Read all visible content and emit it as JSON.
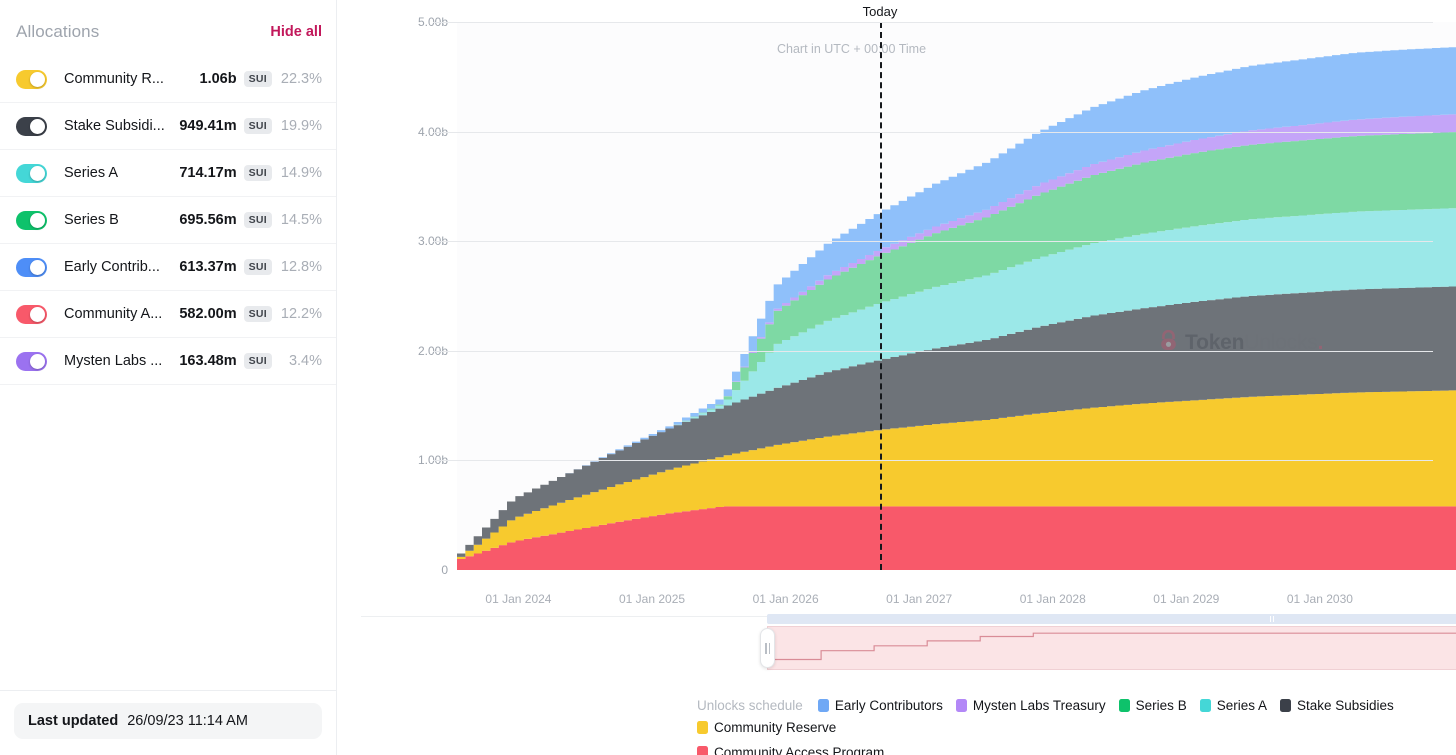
{
  "sidebar": {
    "title": "Allocations",
    "hide_all_label": "Hide all",
    "symbol": "SUI",
    "allocations": [
      {
        "name": "Community R...",
        "full_name": "Community Reserve",
        "amount": "1.06b",
        "percent": "22.3%",
        "color": "#f7ca2e",
        "enabled": true
      },
      {
        "name": "Stake Subsidi...",
        "full_name": "Stake Subsidies",
        "amount": "949.41m",
        "percent": "19.9%",
        "color": "#3b4049",
        "enabled": true
      },
      {
        "name": "Series A",
        "full_name": "Series A",
        "amount": "714.17m",
        "percent": "14.9%",
        "color": "#44d7d7",
        "enabled": true
      },
      {
        "name": "Series B",
        "full_name": "Series B",
        "amount": "695.56m",
        "percent": "14.5%",
        "color": "#0ec26b",
        "enabled": true
      },
      {
        "name": "Early Contrib...",
        "full_name": "Early Contributors",
        "amount": "613.37m",
        "percent": "12.8%",
        "color": "#4e8ef7",
        "enabled": true
      },
      {
        "name": "Community A...",
        "full_name": "Community Access Program",
        "amount": "582.00m",
        "percent": "12.2%",
        "color": "#f8596a",
        "enabled": true
      },
      {
        "name": "Mysten Labs ...",
        "full_name": "Mysten Labs Treasury",
        "amount": "163.48m",
        "percent": "3.4%",
        "color": "#9b72f0",
        "enabled": true
      }
    ],
    "footer": {
      "last_updated_label": "Last updated",
      "last_updated_value": "26/09/23 11:14 AM"
    }
  },
  "chart_annotations": {
    "today_label": "Today",
    "utc_note": "Chart in UTC + 00:00 Time",
    "watermark_bold": "Token",
    "watermark_light": "Unlocks",
    "watermark_dot": "."
  },
  "legend": {
    "title": "Unlocks schedule",
    "items": [
      {
        "label": "Early Contributors",
        "color": "#6fa8f5"
      },
      {
        "label": "Mysten Labs Treasury",
        "color": "#b388f7"
      },
      {
        "label": "Series B",
        "color": "#0ec26b"
      },
      {
        "label": "Series A",
        "color": "#44d7d7"
      },
      {
        "label": "Stake Subsidies",
        "color": "#3b4049"
      },
      {
        "label": "Community Reserve",
        "color": "#f7ca2e"
      }
    ],
    "items_row2": [
      {
        "label": "Community Access Program",
        "color": "#f8596a"
      }
    ]
  },
  "chart_data": {
    "type": "area",
    "title": "Unlocks schedule",
    "subtitle": "Chart in UTC + 00:00 Time",
    "xlabel": "",
    "ylabel": "",
    "stacked": true,
    "grid": true,
    "legend_position": "bottom",
    "ylim": [
      0,
      5000000000
    ],
    "ytick_labels": [
      "0",
      "1.00b",
      "2.00b",
      "3.00b",
      "4.00b",
      "5.00b"
    ],
    "ytick_values": [
      0,
      1000000000,
      2000000000,
      3000000000,
      4000000000,
      5000000000
    ],
    "xtick_labels": [
      "01 Jan 2024",
      "01 Jan 2025",
      "01 Jan 2026",
      "01 Jan 2027",
      "01 Jan 2028",
      "01 Jan 2029",
      "01 Jan 2030"
    ],
    "x": [
      "2023-06",
      "2023-09",
      "2023-12",
      "2024-03",
      "2024-06",
      "2024-09",
      "2024-12",
      "2025-03",
      "2025-06",
      "2025-09",
      "2025-12",
      "2026-06",
      "2026-12",
      "2027-06",
      "2027-12",
      "2028-06",
      "2028-12",
      "2029-06",
      "2029-12",
      "2030-06"
    ],
    "today_marker": "2023-09-26",
    "series": [
      {
        "name": "Community Access Program",
        "color": "#f8596a",
        "values": [
          0.1,
          0.26,
          0.35,
          0.44,
          0.52,
          0.58,
          0.58,
          0.58,
          0.58,
          0.58,
          0.58,
          0.58,
          0.58,
          0.58,
          0.58,
          0.58,
          0.58,
          0.58,
          0.58,
          0.58
        ],
        "unit": "b"
      },
      {
        "name": "Community Reserve",
        "color": "#f7ca2e",
        "values": [
          0.02,
          0.21,
          0.28,
          0.34,
          0.4,
          0.46,
          0.56,
          0.64,
          0.7,
          0.75,
          0.79,
          0.85,
          0.9,
          0.94,
          0.97,
          1.0,
          1.02,
          1.04,
          1.05,
          1.06
        ],
        "unit": "b"
      },
      {
        "name": "Stake Subsidies",
        "color": "#6e7379",
        "values": [
          0.03,
          0.18,
          0.24,
          0.31,
          0.38,
          0.45,
          0.52,
          0.59,
          0.64,
          0.69,
          0.73,
          0.79,
          0.84,
          0.87,
          0.9,
          0.92,
          0.93,
          0.94,
          0.945,
          0.949
        ],
        "unit": "b"
      },
      {
        "name": "Series A",
        "color": "#9be8e8",
        "values": [
          0.0,
          0.0,
          0.0,
          0.0,
          0.0,
          0.03,
          0.4,
          0.47,
          0.52,
          0.56,
          0.59,
          0.63,
          0.66,
          0.68,
          0.69,
          0.7,
          0.705,
          0.71,
          0.712,
          0.714
        ],
        "unit": "b"
      },
      {
        "name": "Series B",
        "color": "#7ed9a4",
        "values": [
          0.0,
          0.0,
          0.0,
          0.0,
          0.0,
          0.01,
          0.3,
          0.38,
          0.44,
          0.49,
          0.53,
          0.58,
          0.62,
          0.65,
          0.67,
          0.68,
          0.685,
          0.69,
          0.693,
          0.695
        ],
        "unit": "b"
      },
      {
        "name": "Mysten Labs Treasury",
        "color": "#c4a5f8",
        "values": [
          0.0,
          0.0,
          0.0,
          0.0,
          0.0,
          0.0,
          0.02,
          0.04,
          0.05,
          0.06,
          0.07,
          0.09,
          0.1,
          0.11,
          0.12,
          0.13,
          0.14,
          0.15,
          0.158,
          0.163
        ],
        "unit": "b"
      },
      {
        "name": "Early Contributors",
        "color": "#8fc0fa",
        "values": [
          0.0,
          0.0,
          0.0,
          0.01,
          0.02,
          0.05,
          0.22,
          0.29,
          0.34,
          0.39,
          0.43,
          0.48,
          0.52,
          0.55,
          0.57,
          0.59,
          0.6,
          0.61,
          0.612,
          0.613
        ],
        "unit": "b"
      }
    ]
  }
}
